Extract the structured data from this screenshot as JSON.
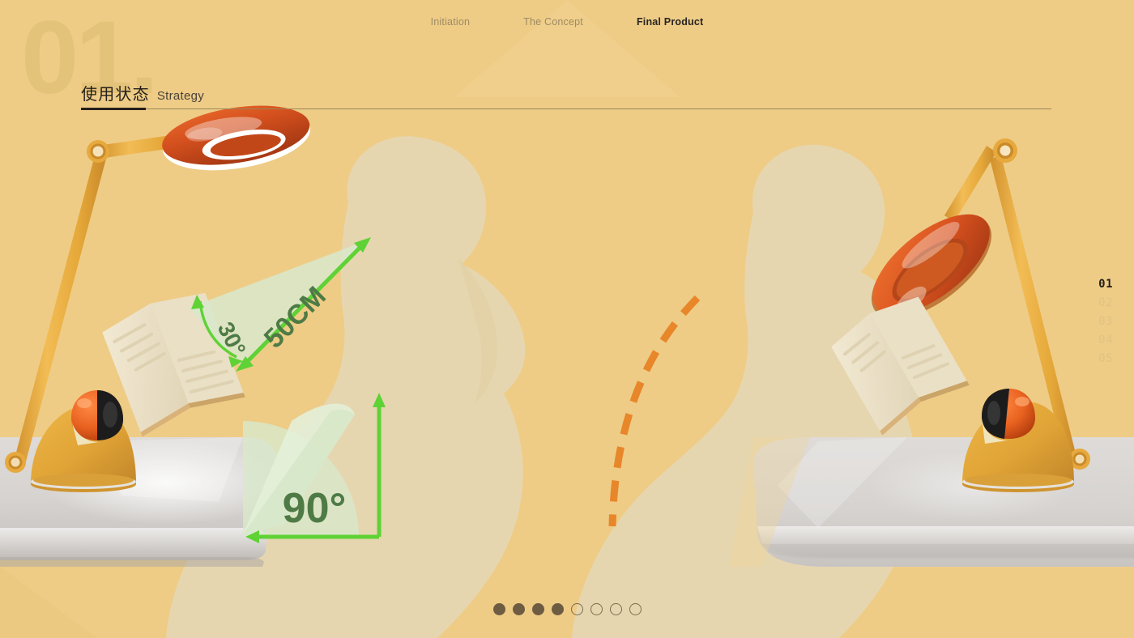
{
  "page": {
    "background_color": "#EECC86",
    "watermark": "01.",
    "slide_number": "01"
  },
  "topnav": {
    "items": [
      {
        "label": "Initiation",
        "active": false
      },
      {
        "label": "The Concept",
        "active": false
      },
      {
        "label": "Final Product",
        "active": true
      }
    ]
  },
  "heading": {
    "title_cn": "使用状态",
    "title_en": "Strategy"
  },
  "pager": {
    "items": [
      {
        "label": "01",
        "active": true
      },
      {
        "label": "02",
        "active": false
      },
      {
        "label": "03",
        "active": false
      },
      {
        "label": "04",
        "active": false
      },
      {
        "label": "05",
        "active": false
      }
    ]
  },
  "carousel": {
    "total": 8,
    "filled": 4,
    "dots": [
      {
        "state": "filled"
      },
      {
        "state": "filled"
      },
      {
        "state": "filled"
      },
      {
        "state": "filled"
      },
      {
        "state": "hollow"
      },
      {
        "state": "hollow"
      },
      {
        "state": "hollow"
      },
      {
        "state": "hollow"
      }
    ]
  },
  "annotations": {
    "angle_view": "30°",
    "distance": "50CM",
    "angle_arm": "90°",
    "accent_color": "#5FD235",
    "label_color": "#4E7A46",
    "wedge_fill": "#D8E8CB",
    "dashed_arc_color": "#E8862A"
  },
  "scene": {
    "left_caption": "lamp-upright-reading-position",
    "right_caption": "lamp-tilted-reading-position",
    "colors": {
      "lamp_arm": "#E8AE43",
      "lamp_base": "#E2A63A",
      "shade_outer": "#D9511F",
      "shade_inner": "#FFFFFF",
      "table": "#D5D2CF",
      "silhouette": "#E6D6B0",
      "book": "#EFE6CF"
    }
  }
}
